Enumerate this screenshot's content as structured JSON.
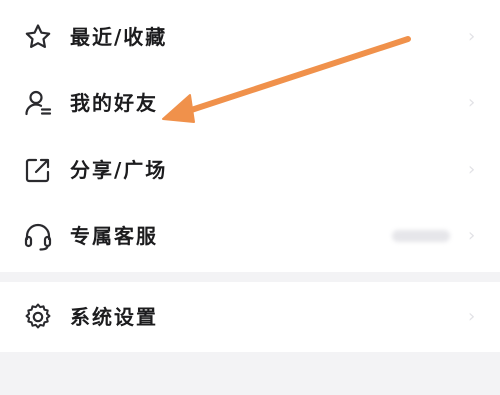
{
  "menu": {
    "items": [
      {
        "id": "recent",
        "label": "最近/收藏",
        "icon": "star-icon"
      },
      {
        "id": "friends",
        "label": "我的好友",
        "icon": "user-list-icon"
      },
      {
        "id": "share",
        "label": "分享/广场",
        "icon": "share-external-icon"
      },
      {
        "id": "support",
        "label": "专属客服",
        "icon": "headset-icon"
      }
    ],
    "settings": {
      "label": "系统设置",
      "icon": "gear-icon"
    }
  },
  "colors": {
    "accent_arrow": "#f0914b",
    "text": "#1c1c1e",
    "background": "#f3f3f5"
  }
}
